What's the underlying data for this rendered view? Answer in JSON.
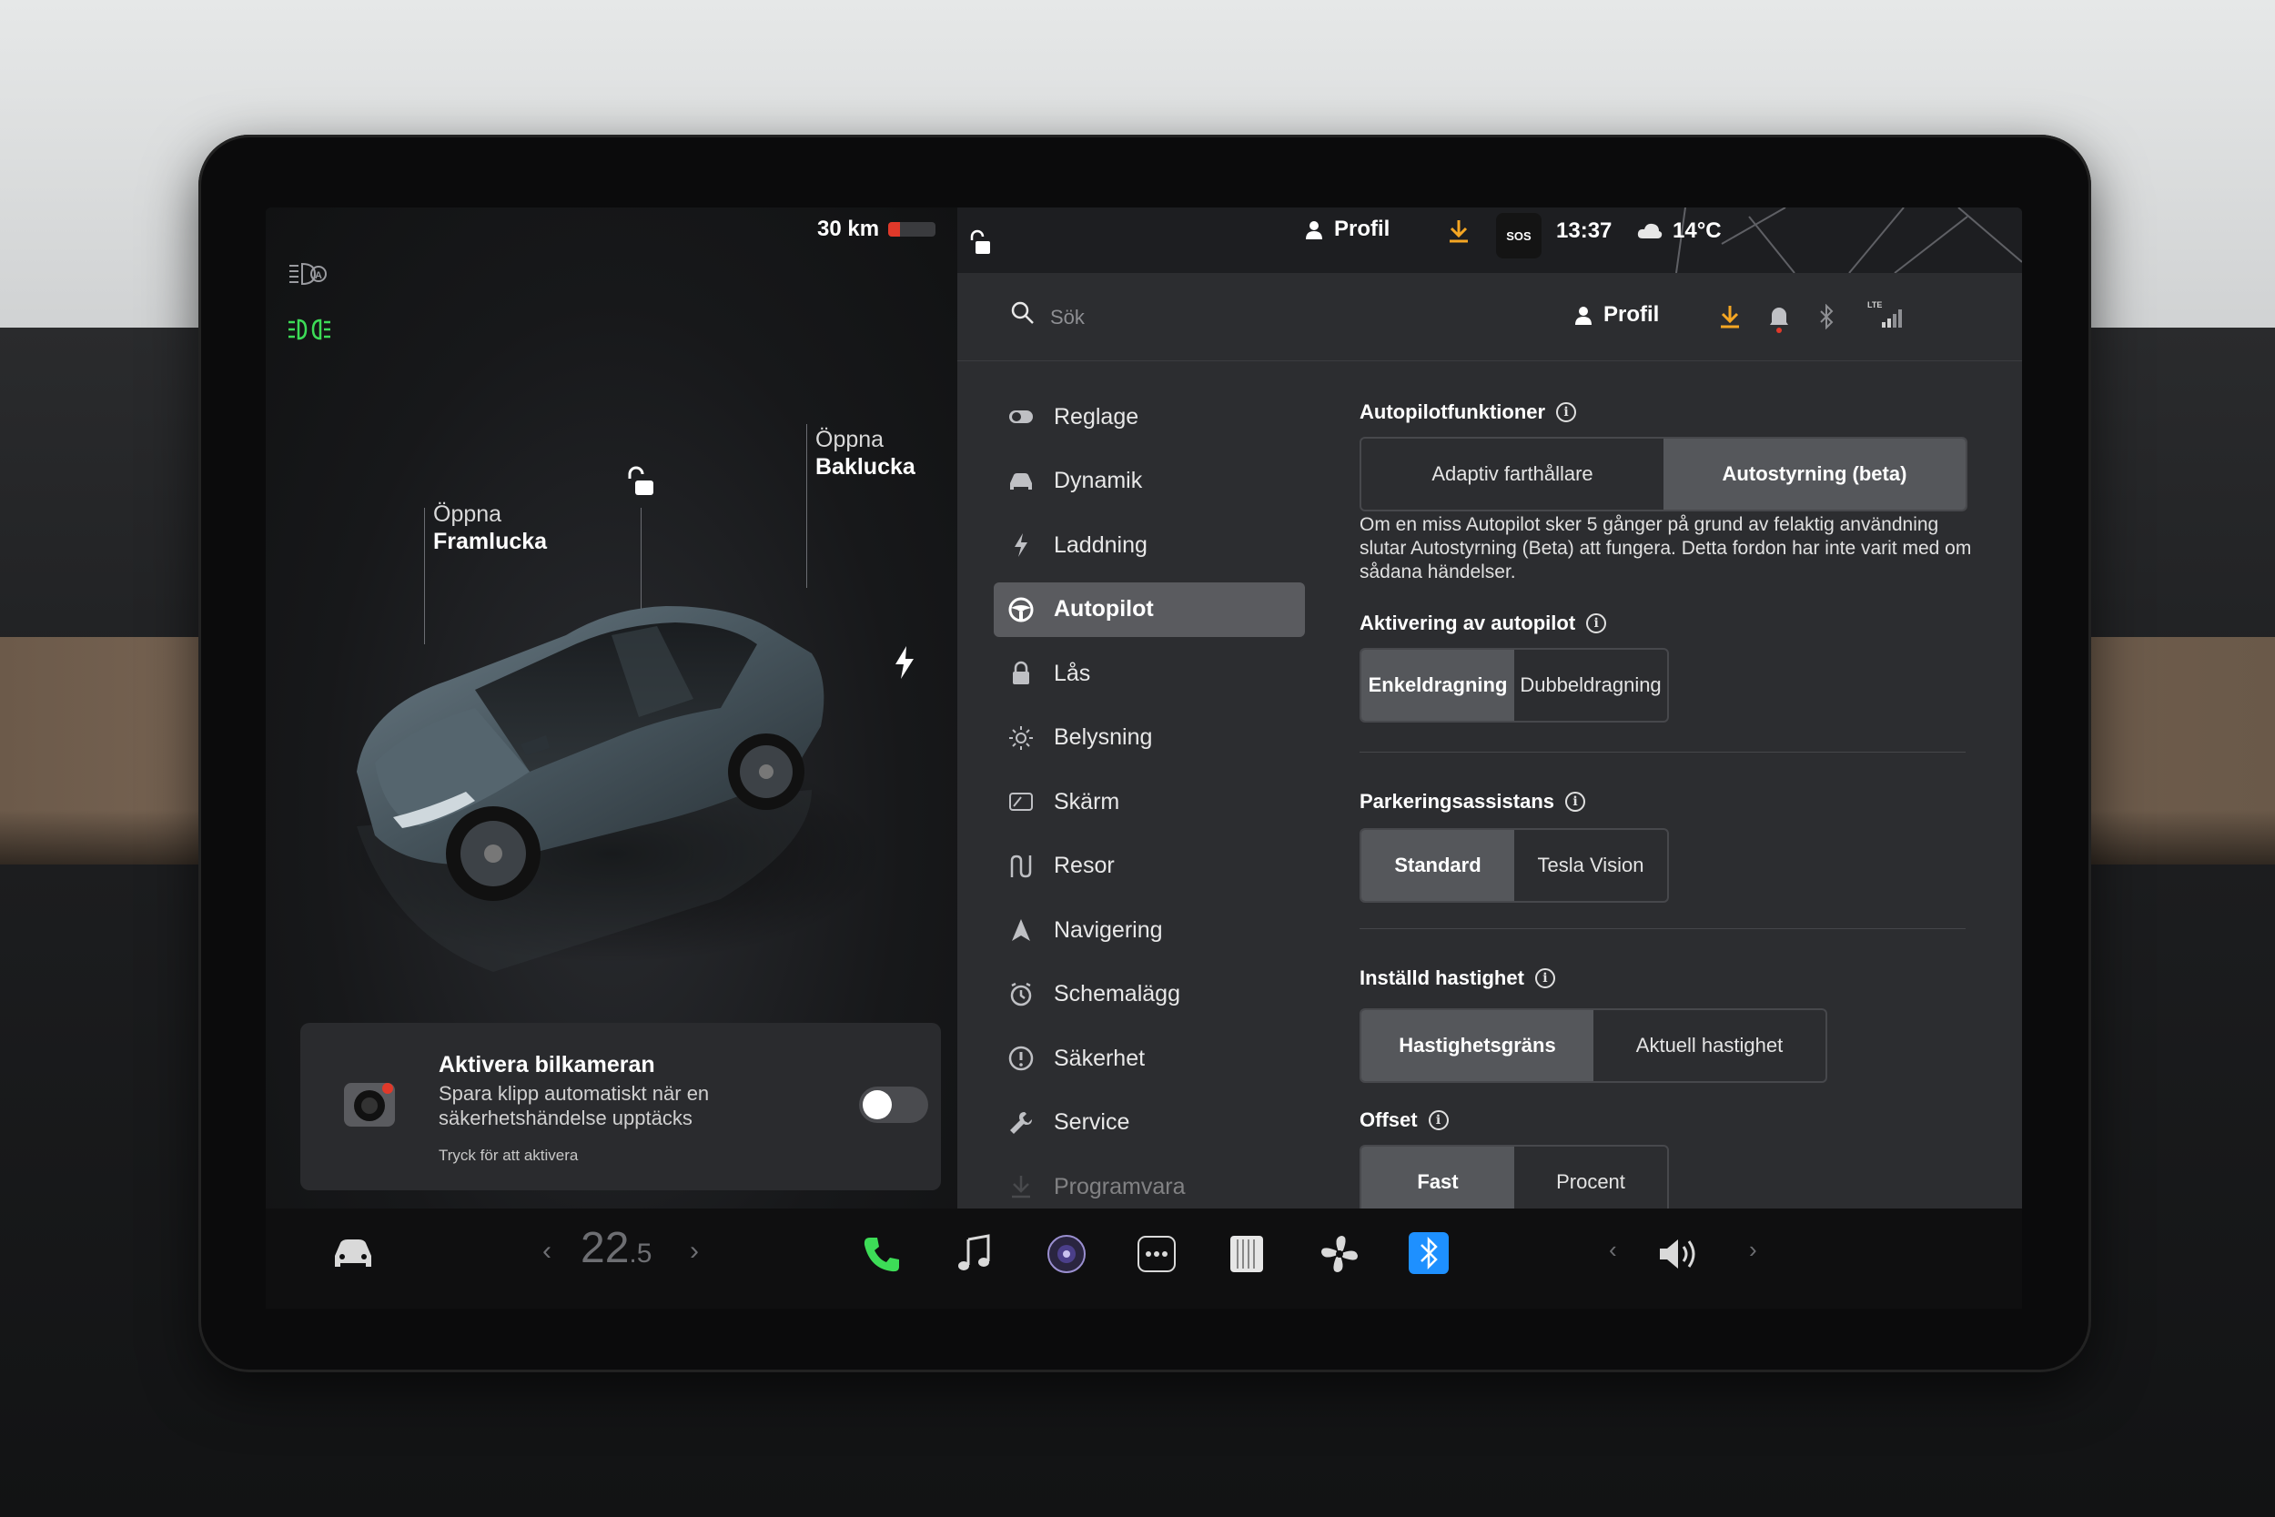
{
  "status": {
    "range": "30 km",
    "battery_level": 0.25,
    "profile_label": "Profil",
    "sos_label": "SOS",
    "time": "13:37",
    "temperature": "14°C",
    "lte_label": "LTE"
  },
  "car_view": {
    "frunk_line1": "Öppna",
    "frunk_line2": "Framlucka",
    "trunk_line1": "Öppna",
    "trunk_line2": "Baklucka"
  },
  "dashcam": {
    "title": "Aktivera bilkameran",
    "description": "Spara klipp automatiskt när en säkerhetshändelse upptäcks",
    "hint": "Tryck för att aktivera",
    "enabled": false
  },
  "search": {
    "placeholder": "Sök"
  },
  "header": {
    "profile_label": "Profil"
  },
  "nav": {
    "items": [
      {
        "label": "Reglage",
        "icon": "toggle-icon"
      },
      {
        "label": "Dynamik",
        "icon": "car-icon"
      },
      {
        "label": "Laddning",
        "icon": "bolt-icon"
      },
      {
        "label": "Autopilot",
        "icon": "steering-wheel-icon"
      },
      {
        "label": "Lås",
        "icon": "lock-icon"
      },
      {
        "label": "Belysning",
        "icon": "sun-icon"
      },
      {
        "label": "Skärm",
        "icon": "display-icon"
      },
      {
        "label": "Resor",
        "icon": "trips-icon"
      },
      {
        "label": "Navigering",
        "icon": "navigation-icon"
      },
      {
        "label": "Schemalägg",
        "icon": "schedule-icon"
      },
      {
        "label": "Säkerhet",
        "icon": "alert-icon"
      },
      {
        "label": "Service",
        "icon": "wrench-icon"
      },
      {
        "label": "Programvara",
        "icon": "download-icon"
      }
    ],
    "active": "Autopilot"
  },
  "autopilot": {
    "features": {
      "title": "Autopilotfunktioner",
      "options": [
        "Adaptiv farthållare",
        "Autostyrning (beta)"
      ],
      "selected": "Autostyrning (beta)",
      "note": "Om en miss Autopilot sker 5 gånger på grund av felaktig användning slutar Autostyrning (Beta) att fungera. Detta fordon har inte varit med om sådana händelser."
    },
    "activation": {
      "title": "Aktivering av autopilot",
      "options": [
        "Enkeldragning",
        "Dubbeldragning"
      ],
      "selected": "Enkeldragning"
    },
    "parking": {
      "title": "Parkeringsassistans",
      "options": [
        "Standard",
        "Tesla Vision"
      ],
      "selected": "Standard"
    },
    "speed": {
      "title": "Inställd hastighet",
      "options": [
        "Hastighetsgräns",
        "Aktuell hastighet"
      ],
      "selected": "Hastighetsgräns"
    },
    "offset": {
      "title": "Offset",
      "options": [
        "Fast",
        "Procent"
      ],
      "selected": "Fast"
    }
  },
  "dock": {
    "temp_main": "22",
    "temp_decimal": ".5",
    "icons": [
      "car-icon",
      "phone-icon",
      "music-icon",
      "camera-icon",
      "more-icon",
      "notes-icon",
      "fan-icon",
      "bluetooth-icon",
      "volume-icon"
    ]
  },
  "colors": {
    "accent_green": "#3ddc57",
    "download_orange": "#f5a623",
    "bluetooth_blue": "#1e90ff",
    "battery_red": "#e0392a",
    "active_nav": "#5a5b5f"
  }
}
